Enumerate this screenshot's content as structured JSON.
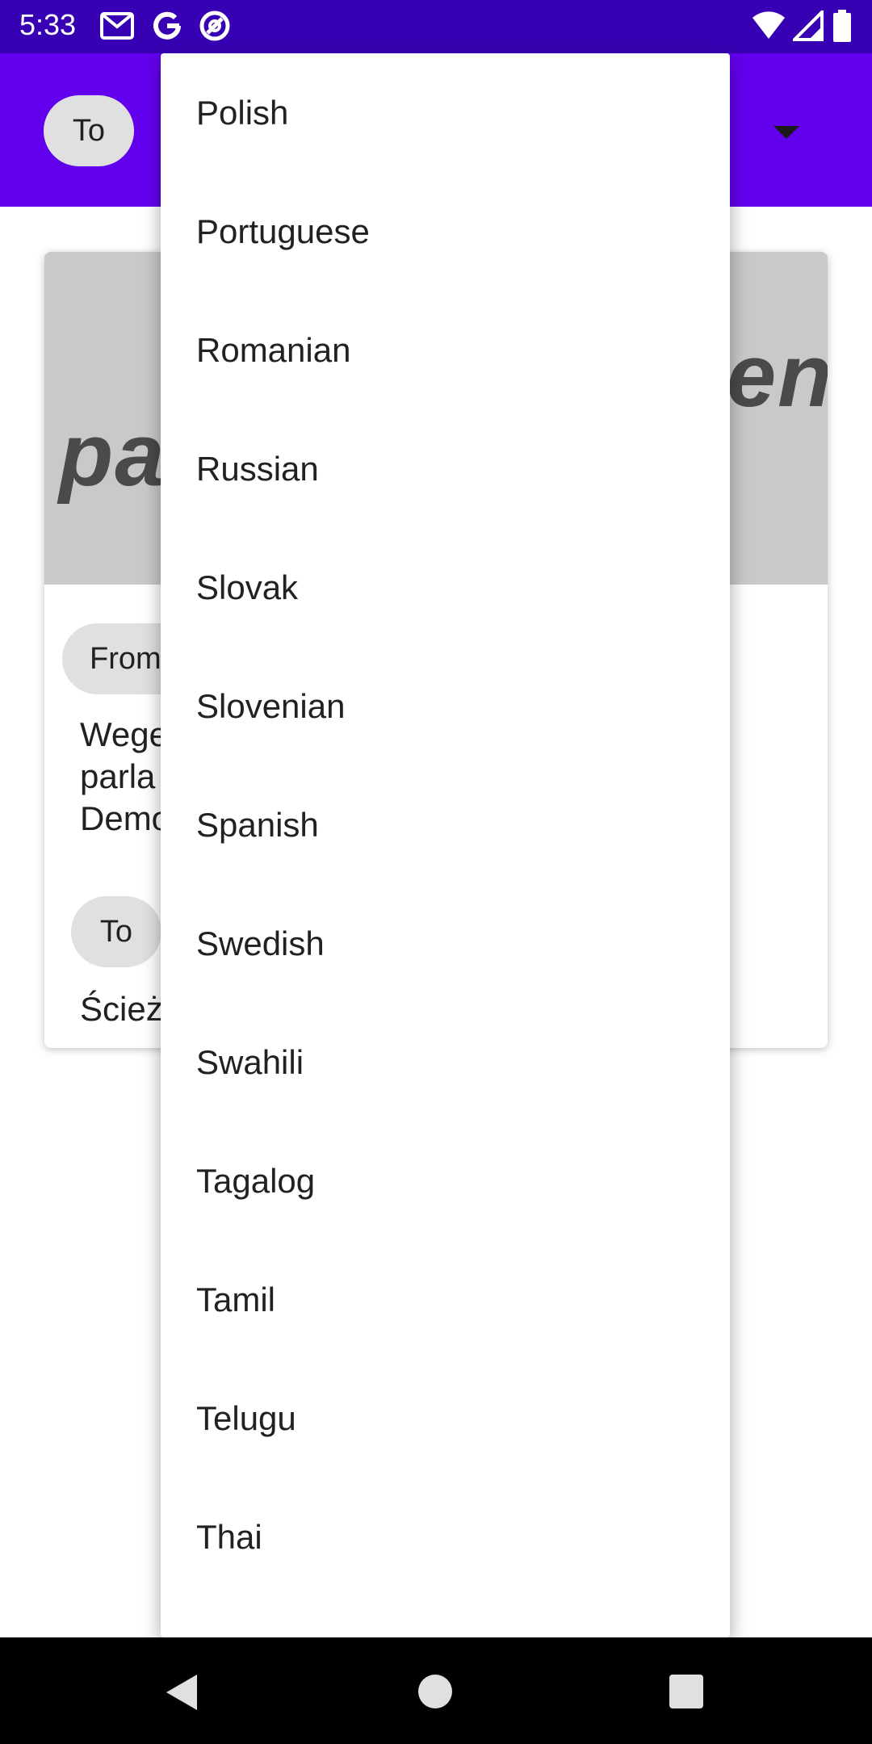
{
  "status_bar": {
    "time": "5:33",
    "icons": [
      "gmail-icon",
      "google-icon",
      "vpn-icon",
      "wifi-icon",
      "signal-icon",
      "battery-icon"
    ]
  },
  "app_bar": {
    "to_chip": "To"
  },
  "card": {
    "image_text_left": "pa",
    "image_text_right": "en",
    "from_chip": "From",
    "source_text": "Wege\nparla\nDemo",
    "to_chip": "To",
    "translated_text": "Ścież"
  },
  "menu": {
    "items": [
      "Polish",
      "Portuguese",
      "Romanian",
      "Russian",
      "Slovak",
      "Slovenian",
      "Spanish",
      "Swedish",
      "Swahili",
      "Tagalog",
      "Tamil",
      "Telugu",
      "Thai"
    ]
  },
  "colors": {
    "status_bar": "#3700B3",
    "app_bar": "#6200EE",
    "chip": "#e0e0e0"
  }
}
